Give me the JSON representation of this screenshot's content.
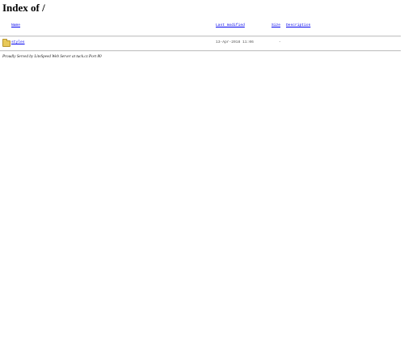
{
  "page": {
    "title": "Index of /"
  },
  "table": {
    "columns": {
      "name": "Name",
      "last_modified": "Last modified",
      "size": "Size",
      "description": "Description"
    },
    "rows": [
      {
        "icon": "folder-icon",
        "name": "styles",
        "last_modified": "13-Apr-2018 11:06",
        "size": "-",
        "description": ""
      }
    ]
  },
  "footer": {
    "text": "Proudly Served by LiteSpeed Web Server at tuck.cz Port 80"
  },
  "colors": {
    "link": "#0000ee",
    "rule": "#c8c8c8",
    "folder": "#e8c95a"
  }
}
